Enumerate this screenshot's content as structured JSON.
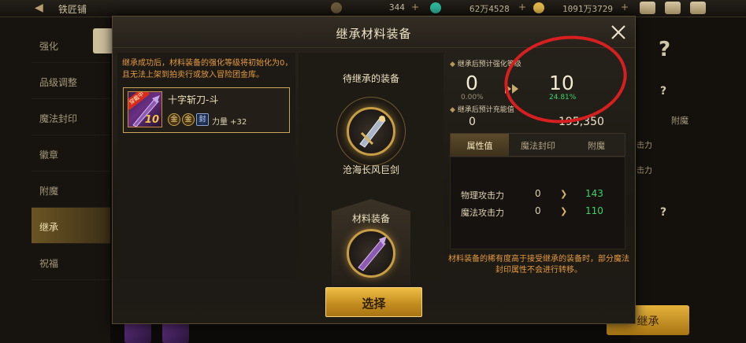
{
  "topbar": {
    "back_icon": "back-arrow-icon",
    "title": "铁匠铺",
    "currency_1": "344",
    "currency_2": "62万4528",
    "currency_3": "1091万3729",
    "plus": "+"
  },
  "sidebar": {
    "items": [
      {
        "label": "强化"
      },
      {
        "label": "品级调整"
      },
      {
        "label": "魔法封印"
      },
      {
        "label": "徽章"
      },
      {
        "label": "附魔"
      },
      {
        "label": "继承"
      },
      {
        "label": "祝福"
      }
    ]
  },
  "background_right": {
    "tab_1": "附魔",
    "button_label": "继承"
  },
  "dialog": {
    "title": "继承材料装备",
    "notice": "继承成功后，材料装备的强化等级将初始化为0，且无法上架到拍卖行或放入冒险团金库。",
    "item": {
      "tag": "穿戴中",
      "level": "10",
      "name": "十字斩刀-斗",
      "stat": "力量 +32",
      "badge_1": "金",
      "badge_2": "金",
      "badge_3": "封"
    },
    "inherit_slot": {
      "label": "待继承的装备",
      "item_name": "沧海长风巨剑"
    },
    "material_slot": {
      "label": "材料装备"
    },
    "result": {
      "enhance_header": "继承后预计强化等级",
      "enhance_from": "0",
      "enhance_from_pct": "0.00%",
      "enhance_to": "10",
      "enhance_to_pct": "24.81%",
      "fill_header": "继承后预计充能值",
      "fill_from": "0",
      "fill_to": "195,350",
      "tabs": [
        "属性值",
        "魔法封印",
        "附魔"
      ],
      "stats": [
        {
          "label": "物理攻击力",
          "from": "0",
          "to": "143"
        },
        {
          "label": "魔法攻击力",
          "from": "0",
          "to": "110"
        }
      ],
      "warning": "材料装备的稀有度高于接受继承的装备时，部分魔法封印属性不会进行转移。"
    },
    "select_button": "选择"
  },
  "colors": {
    "accent_gold": "#c79d45",
    "warning_orange": "#e39a42",
    "increase_green": "#3fd26b",
    "highlight_red": "#d81f1f"
  }
}
